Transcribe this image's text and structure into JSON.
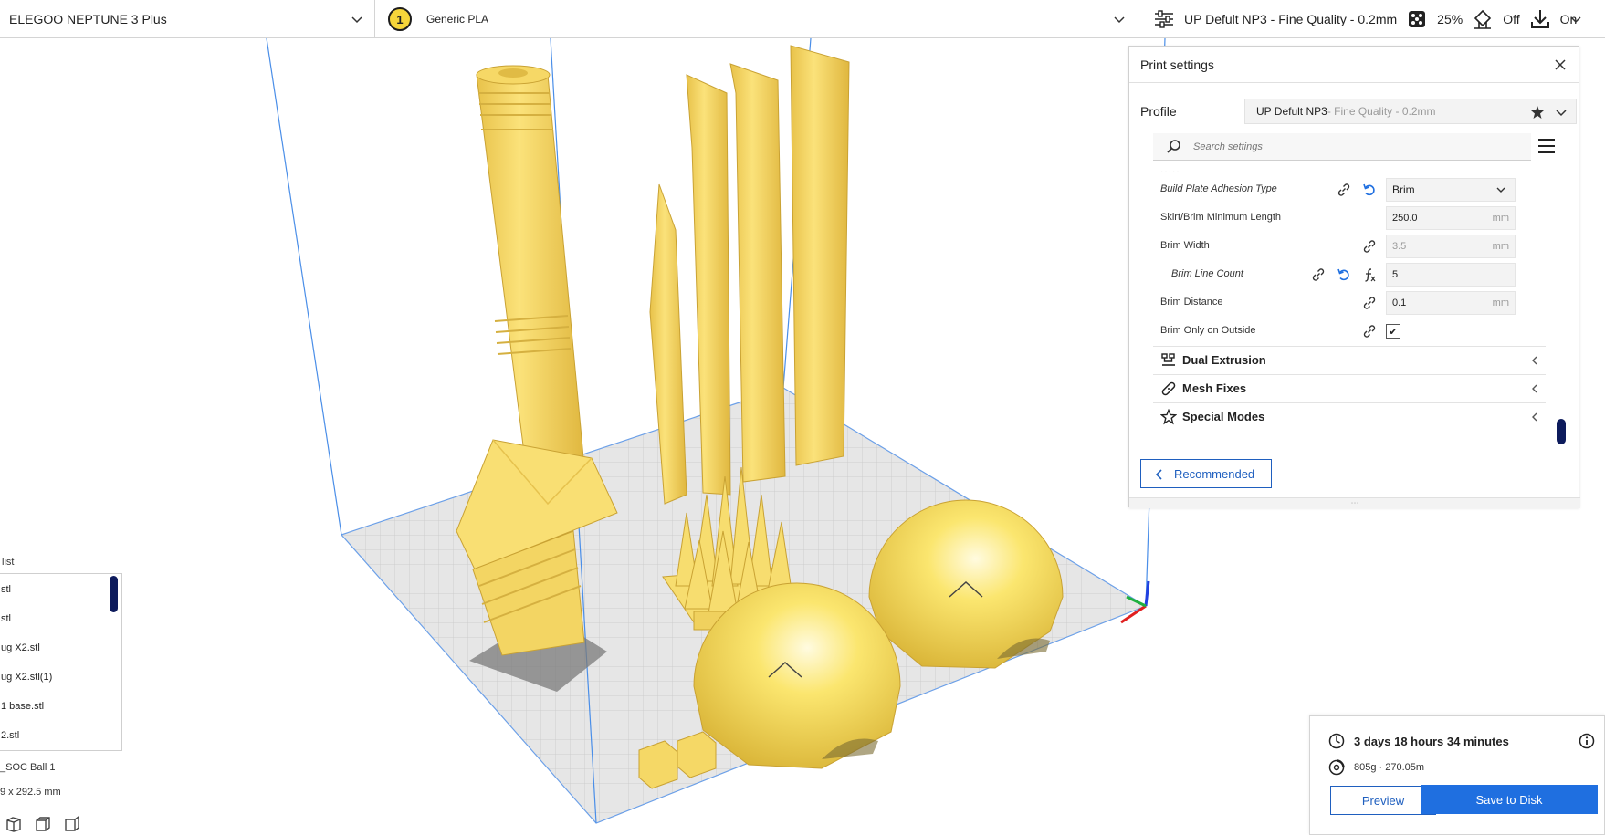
{
  "topbar": {
    "printer_name": "ELEGOO NEPTUNE 3 Plus",
    "extruder_number": "1",
    "material_name": "Generic PLA",
    "profile_summary": "UP Defult NP3 - Fine Quality - 0.2mm",
    "infill": "25%",
    "support": "Off",
    "adhesion": "On"
  },
  "panel": {
    "title": "Print settings",
    "profile_label": "Profile",
    "profile_name": "UP Defult NP3",
    "profile_quality": " - Fine Quality - 0.2mm",
    "search_placeholder": "Search settings",
    "dots": "·····",
    "settings": [
      {
        "label": "Build Plate Adhesion Type",
        "value": "Brim"
      },
      {
        "label": "Skirt/Brim Minimum Length",
        "value": "250.0",
        "unit": "mm"
      },
      {
        "label": "Brim Width",
        "value": "3.5",
        "unit": "mm"
      },
      {
        "label": "Brim Line Count",
        "value": "5"
      },
      {
        "label": "Brim Distance",
        "value": "0.1",
        "unit": "mm"
      },
      {
        "label": "Brim Only on Outside",
        "value": "✔"
      }
    ],
    "categories": [
      {
        "label": "Dual Extrusion"
      },
      {
        "label": "Mesh Fixes"
      },
      {
        "label": "Special Modes"
      }
    ],
    "recommended_label": "Recommended",
    "grip": "⋯"
  },
  "object_list": {
    "title": "list",
    "items": [
      {
        "label": "stl"
      },
      {
        "label": "stl"
      },
      {
        "label": "ug X2.stl"
      },
      {
        "label": "ug X2.stl(1)"
      },
      {
        "label": "1 base.stl"
      },
      {
        "label": "2.stl"
      }
    ],
    "selected_name": "_SOC Ball 1",
    "dimensions": "9 x 292.5 mm"
  },
  "estimate": {
    "time": "3 days 18 hours 34 minutes",
    "material": "805g · 270.05m",
    "preview_label": "Preview",
    "save_label": "Save to Disk"
  },
  "colors": {
    "accent": "#1f6fe0",
    "model_yellow": "#f7dd6f",
    "build_plate": "#e3e3e3",
    "frame_blue": "#4a8ee8",
    "scroll_thumb": "#0d1b5c"
  }
}
